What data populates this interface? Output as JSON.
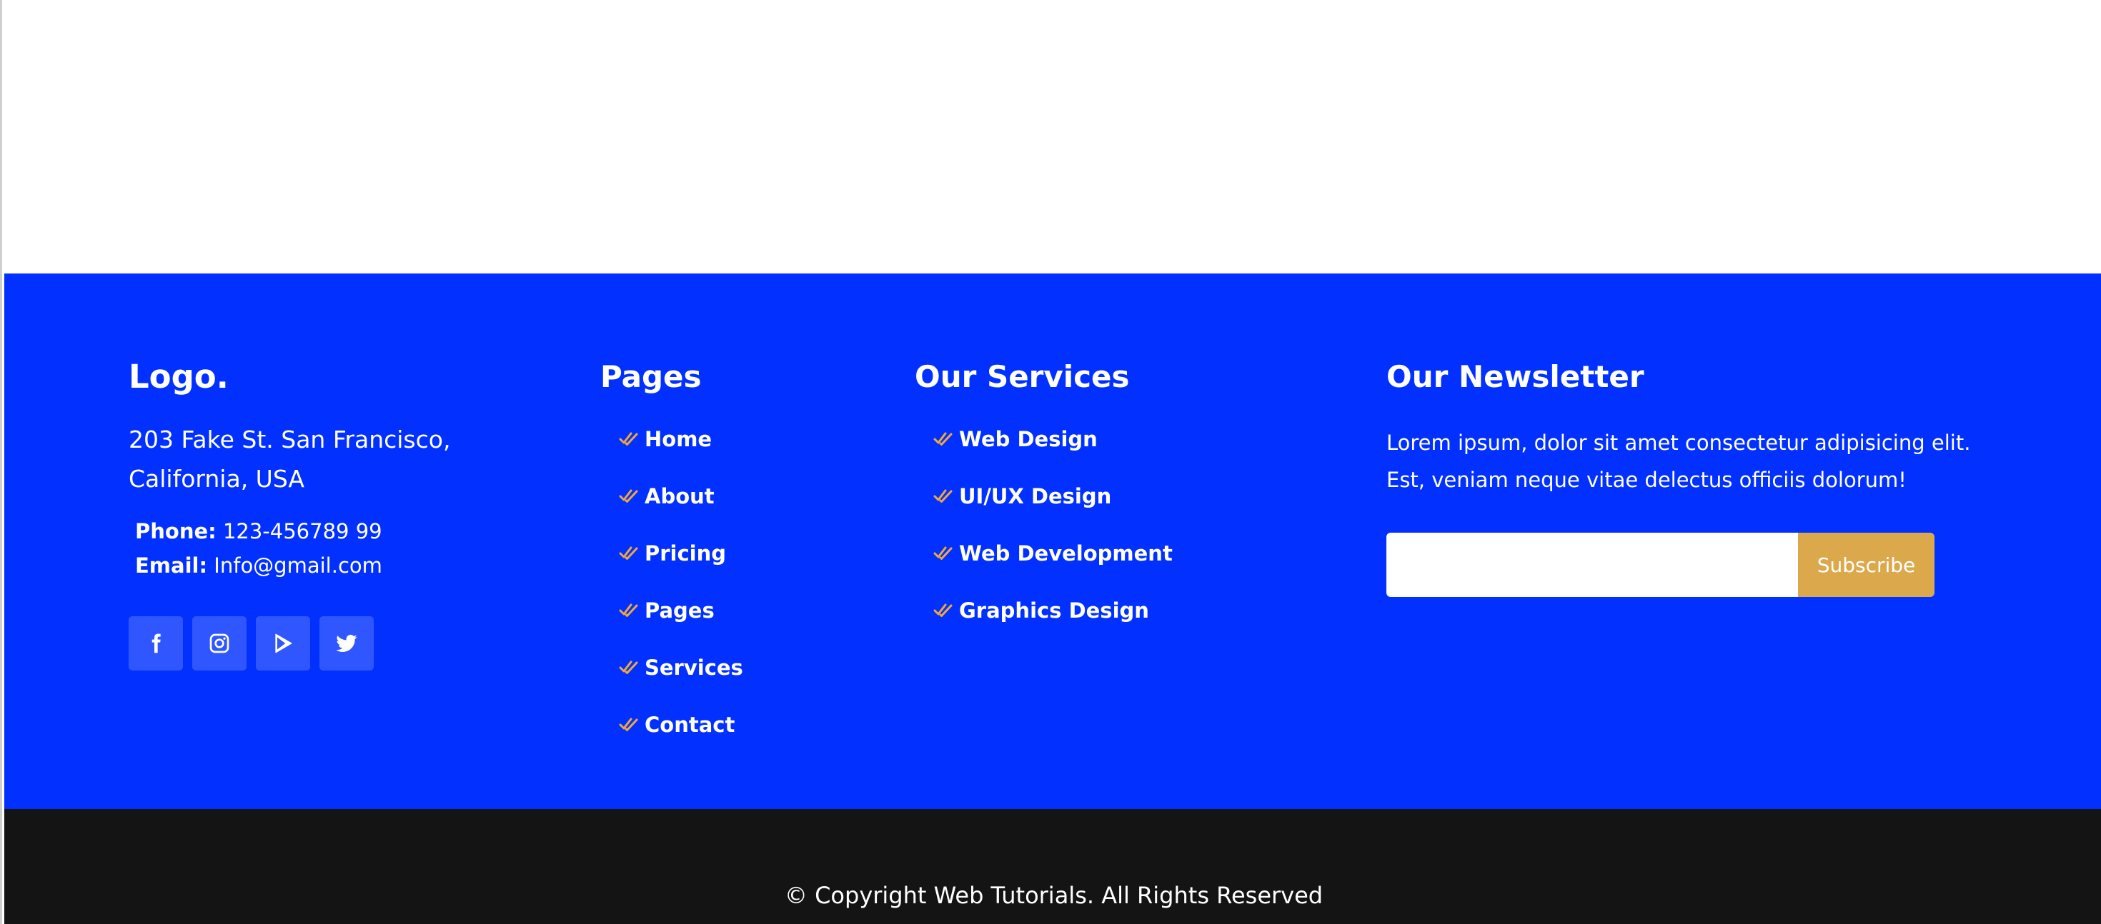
{
  "brand": {
    "logo": "Logo.",
    "address_line1": "203 Fake St. San Francisco,",
    "address_line2": "California, USA",
    "phone_label": "Phone:",
    "phone_value": "123-456789 99",
    "email_label": "Email:",
    "email_value": "Info@gmail.com",
    "socials": [
      "facebook-icon",
      "instagram-icon",
      "google-play-icon",
      "twitter-icon"
    ]
  },
  "pages": {
    "title": "Pages",
    "items": [
      {
        "label": "Home"
      },
      {
        "label": "About"
      },
      {
        "label": "Pricing"
      },
      {
        "label": "Pages"
      },
      {
        "label": "Services"
      },
      {
        "label": "Contact"
      }
    ]
  },
  "services": {
    "title": "Our Services",
    "items": [
      {
        "label": "Web Design"
      },
      {
        "label": "UI/UX Design"
      },
      {
        "label": "Web Development"
      },
      {
        "label": "Graphics Design"
      }
    ]
  },
  "newsletter": {
    "title": "Our Newsletter",
    "text": "Lorem ipsum, dolor sit amet consectetur adipisicing elit. Est, veniam neque vitae delectus officiis dolorum!",
    "input_placeholder": "",
    "button_label": "Subscribe"
  },
  "copyright": "© Copyright Web Tutorials. All Rights Reserved",
  "colors": {
    "footer_bg": "#0231ff",
    "bottom_bg": "#141414",
    "accent": "#dba84b",
    "check": "#f0a83c"
  }
}
